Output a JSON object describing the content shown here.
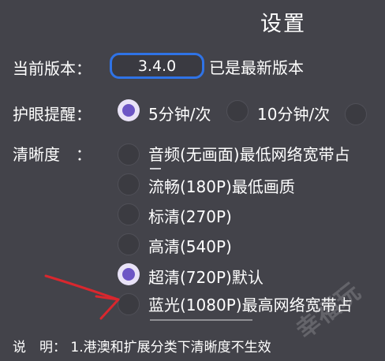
{
  "header": {
    "title": "设置"
  },
  "version": {
    "label": "当前版本：",
    "value": "3.4.0",
    "status": "已是最新版本"
  },
  "eye_reminder": {
    "label": "护眼提醒：",
    "options": [
      {
        "label": "5分钟/次",
        "selected": true
      },
      {
        "label": "10分钟/次",
        "selected": false
      },
      {
        "label": "",
        "selected": false
      }
    ]
  },
  "resolution": {
    "label": "清晰度　：",
    "options": [
      {
        "label": "音频(无画面)最低网络宽带占",
        "selected": false
      },
      {
        "label": "流畅(180P)最低画质",
        "selected": false
      },
      {
        "label": "标清(270P)",
        "selected": false
      },
      {
        "label": "高清(540P)",
        "selected": false
      },
      {
        "label": "超清(720P)默认",
        "selected": true
      },
      {
        "label": "蓝光(1080P)最高网络宽带占",
        "selected": false
      }
    ]
  },
  "notes": {
    "text": "说　明：  1.港澳和扩展分类下清晰度不生效"
  },
  "watermark": {
    "text": "幸福玩"
  },
  "colors": {
    "background": "#43434a",
    "accent": "#6d56c5",
    "pill_border": "#2f73e6",
    "annotation": "#d9272e"
  }
}
